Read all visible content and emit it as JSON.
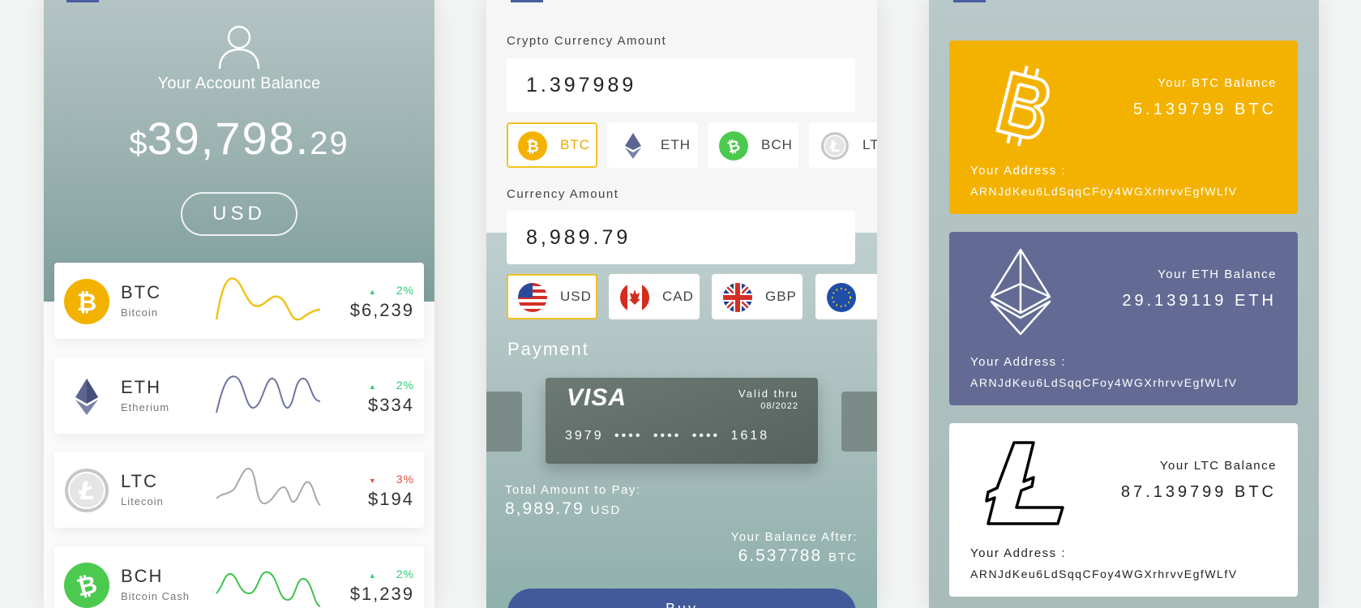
{
  "colors": {
    "btc": "#f4b200",
    "eth": "#636b94",
    "ltc": "#9e9e9e",
    "bch": "#4cc94f",
    "up": "#2ecc71",
    "down": "#e74c3c",
    "accent_blue": "#42599a",
    "selected_border": "#f2c21c"
  },
  "balance_screen": {
    "account_label": "Your Account Balance",
    "currency_symbol": "$",
    "balance_whole": "39,798.",
    "balance_cents": "29",
    "currency_button": "USD",
    "coins": [
      {
        "symbol": "BTC",
        "name": "Bitcoin",
        "change": "2%",
        "direction": "up",
        "price": "$6,239",
        "icon": "bitcoin-icon"
      },
      {
        "symbol": "ETH",
        "name": "Etherium",
        "change": "2%",
        "direction": "up",
        "price": "$334",
        "icon": "ethereum-icon"
      },
      {
        "symbol": "LTC",
        "name": "Litecoin",
        "change": "3%",
        "direction": "down",
        "price": "$194",
        "icon": "litecoin-icon"
      },
      {
        "symbol": "BCH",
        "name": "Bitcoin Cash",
        "change": "2%",
        "direction": "up",
        "price": "$1,239",
        "icon": "bitcoin-cash-icon"
      }
    ]
  },
  "buy_screen": {
    "crypto_amount_label": "Crypto Currency Amount",
    "crypto_amount_value": "1.397989",
    "crypto_chips": [
      {
        "label": "BTC",
        "icon": "bitcoin-icon",
        "selected": true
      },
      {
        "label": "ETH",
        "icon": "ethereum-icon",
        "selected": false
      },
      {
        "label": "BCH",
        "icon": "bitcoin-cash-icon",
        "selected": false
      },
      {
        "label": "LT",
        "icon": "litecoin-icon",
        "selected": false
      }
    ],
    "currency_amount_label": "Currency Amount",
    "currency_amount_value": "8,989.79",
    "fiat_chips": [
      {
        "label": "USD",
        "icon": "us-flag-icon",
        "selected": true
      },
      {
        "label": "CAD",
        "icon": "canada-flag-icon",
        "selected": false
      },
      {
        "label": "GBP",
        "icon": "uk-flag-icon",
        "selected": false
      },
      {
        "label": "",
        "icon": "eu-flag-icon",
        "selected": false
      }
    ],
    "payment_label": "Payment",
    "card": {
      "brand": "VISA",
      "valid_label": "Valid thru",
      "expiry": "08/2022",
      "number": "3979 •••• •••• •••• 1618"
    },
    "total_label": "Total Amount to Pay:",
    "total_value": "8,989.79",
    "total_unit": "USD",
    "after_label": "Your Balance After:",
    "after_value": "6.537788",
    "after_unit": "BTC",
    "buy_button": "Buy"
  },
  "wallet_screen": {
    "wallets": [
      {
        "title": "Your BTC Balance",
        "balance": "5.139799 BTC",
        "address_label": "Your Address :",
        "address": "ARNJdKeu6LdSqqCFoy4WGXrhrvvEgfWLfV",
        "icon": "bitcoin-icon"
      },
      {
        "title": "Your ETH Balance",
        "balance": "29.139119 ETH",
        "address_label": "Your Address :",
        "address": "ARNJdKeu6LdSqqCFoy4WGXrhrvvEgfWLfV",
        "icon": "ethereum-icon"
      },
      {
        "title": "Your LTC Balance",
        "balance": "87.139799 BTC",
        "address_label": "Your Address :",
        "address": "ARNJdKeu6LdSqqCFoy4WGXrhrvvEgfWLfV",
        "icon": "litecoin-icon"
      }
    ]
  }
}
